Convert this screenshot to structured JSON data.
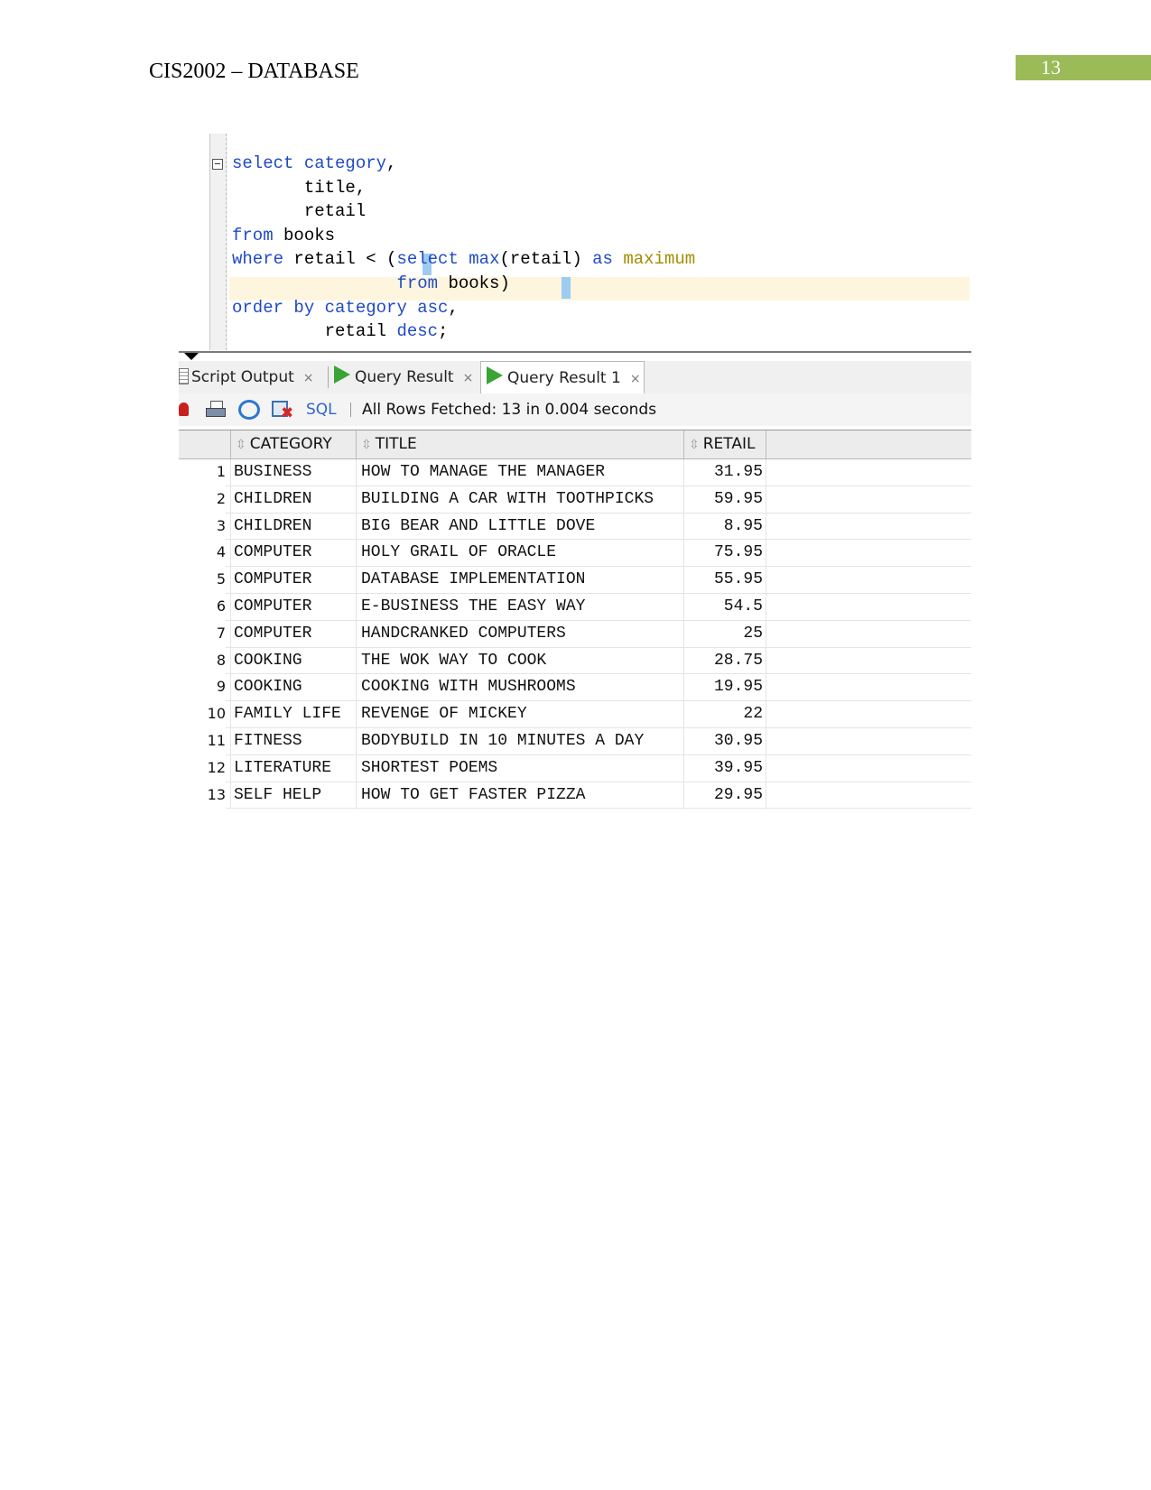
{
  "document": {
    "header": "CIS2002 – DATABASE",
    "page_number": "13"
  },
  "editor": {
    "lines": [
      [
        {
          "t": "select",
          "c": "kw"
        },
        {
          "t": " "
        },
        {
          "t": "category",
          "c": "kw"
        },
        {
          "t": ","
        }
      ],
      [
        {
          "t": "       title,"
        }
      ],
      [
        {
          "t": "       retail"
        }
      ],
      [
        {
          "t": "from",
          "c": "kw"
        },
        {
          "t": " books"
        }
      ],
      [
        {
          "t": "where",
          "c": "kw"
        },
        {
          "t": " retail < "
        },
        {
          "t": "(",
          "c": "paren"
        },
        {
          "t": "select",
          "c": "kw"
        },
        {
          "t": " "
        },
        {
          "t": "max",
          "c": "fn"
        },
        {
          "t": "(retail) "
        },
        {
          "t": "as",
          "c": "kw"
        },
        {
          "t": " "
        },
        {
          "t": "maximum",
          "c": "alias"
        }
      ],
      [
        {
          "t": "                "
        },
        {
          "t": "from",
          "c": "kw"
        },
        {
          "t": " books"
        },
        {
          "t": ")",
          "c": "paren"
        }
      ],
      [
        {
          "t": "order by",
          "c": "kw"
        },
        {
          "t": " "
        },
        {
          "t": "category",
          "c": "kw"
        },
        {
          "t": " "
        },
        {
          "t": "asc",
          "c": "kw"
        },
        {
          "t": ","
        }
      ],
      [
        {
          "t": "         retail "
        },
        {
          "t": "desc",
          "c": "kw"
        },
        {
          "t": ";"
        }
      ]
    ]
  },
  "tabs": {
    "script_output": "Script Output",
    "query_result": "Query Result",
    "query_result_1": "Query Result 1",
    "close_glyph": "×"
  },
  "toolbar": {
    "sql_label": "SQL",
    "separator": "|",
    "status": "All Rows Fetched: 13 in 0.004 seconds"
  },
  "grid": {
    "columns": [
      "CATEGORY",
      "TITLE",
      "RETAIL"
    ],
    "rows": [
      [
        "1",
        "BUSINESS",
        "HOW TO MANAGE THE MANAGER",
        "31.95"
      ],
      [
        "2",
        "CHILDREN",
        "BUILDING A CAR WITH TOOTHPICKS",
        "59.95"
      ],
      [
        "3",
        "CHILDREN",
        "BIG BEAR AND LITTLE DOVE",
        "8.95"
      ],
      [
        "4",
        "COMPUTER",
        "HOLY GRAIL OF ORACLE",
        "75.95"
      ],
      [
        "5",
        "COMPUTER",
        "DATABASE IMPLEMENTATION",
        "55.95"
      ],
      [
        "6",
        "COMPUTER",
        "E-BUSINESS THE EASY WAY",
        "54.5"
      ],
      [
        "7",
        "COMPUTER",
        "HANDCRANKED COMPUTERS",
        "25"
      ],
      [
        "8",
        "COOKING",
        "THE WOK WAY TO COOK",
        "28.75"
      ],
      [
        "9",
        "COOKING",
        "COOKING WITH MUSHROOMS",
        "19.95"
      ],
      [
        "10",
        "FAMILY LIFE",
        "REVENGE OF MICKEY",
        "22"
      ],
      [
        "11",
        "FITNESS",
        "BODYBUILD IN 10 MINUTES A DAY",
        "30.95"
      ],
      [
        "12",
        "LITERATURE",
        "SHORTEST POEMS",
        "39.95"
      ],
      [
        "13",
        "SELF HELP",
        "HOW TO GET FASTER PIZZA",
        "29.95"
      ]
    ]
  },
  "colors": {
    "page_tab": "#9bbb59",
    "keyword": "#1f4ac4",
    "alias": "#a08d00",
    "highlight_line": "#fdf5dd",
    "paren_match": "#9ecbf1",
    "run_green": "#3aa435"
  },
  "icons": [
    "fold-minus-icon",
    "doc-icon",
    "play-icon",
    "pin-icon",
    "print-icon",
    "refresh-icon",
    "delete-icon",
    "sort-icon"
  ]
}
